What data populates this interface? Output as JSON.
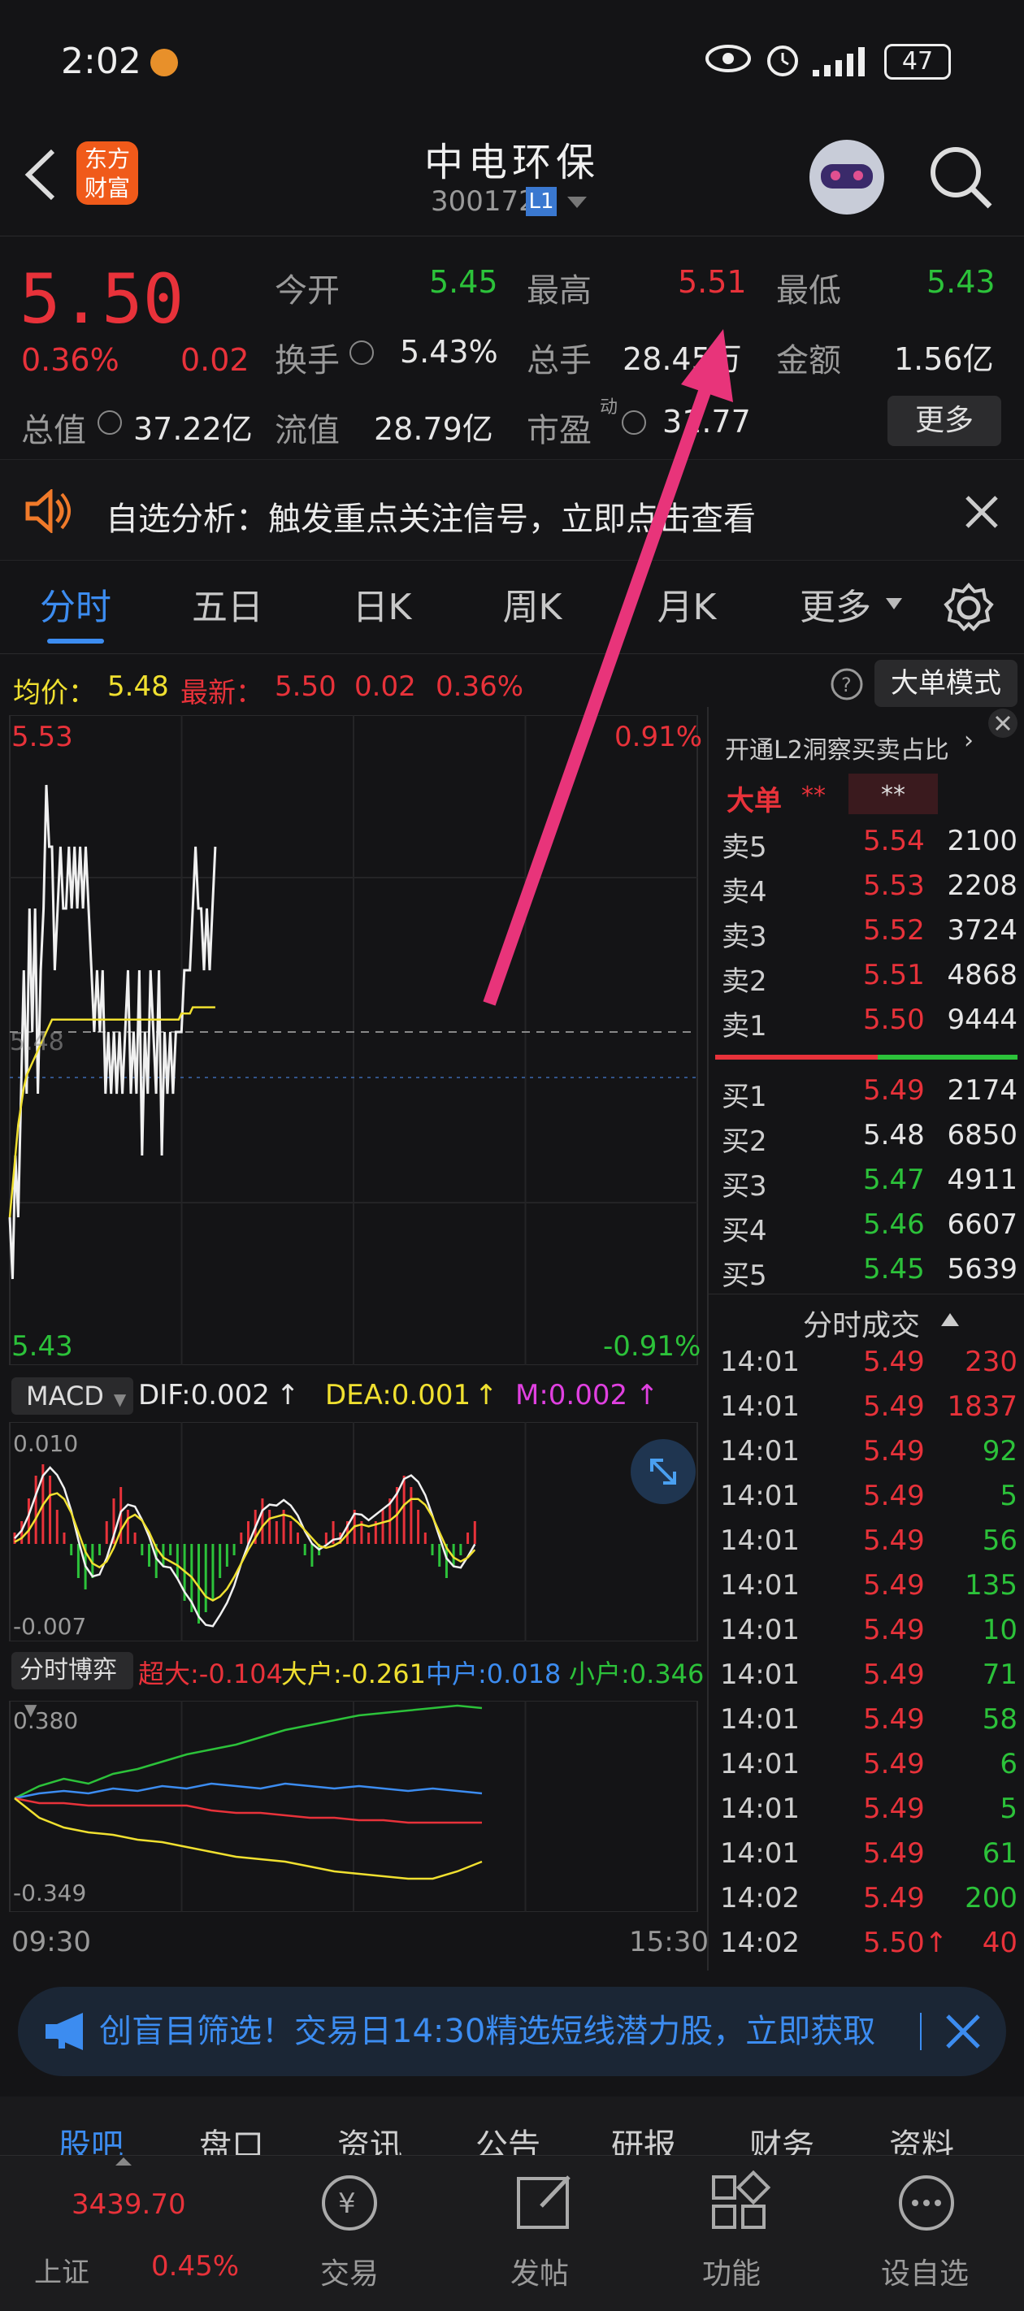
{
  "status_bar": {
    "time": "2:02",
    "battery": "47"
  },
  "header": {
    "title": "中电环保",
    "code": "300172",
    "level_badge": "L1",
    "logo_line1": "东方",
    "logo_line2": "财富"
  },
  "quote": {
    "price": "5.50",
    "change_pct": "0.36%",
    "change": "0.02",
    "open_label": "今开",
    "open": "5.45",
    "high_label": "最高",
    "high": "5.51",
    "low_label": "最低",
    "low": "5.43",
    "turnover_label": "换手",
    "turnover": "5.43%",
    "volume_label": "总手",
    "volume": "28.45万",
    "amount_label": "金额",
    "amount": "1.56亿",
    "mktcap_label": "总值",
    "mktcap": "37.22亿",
    "float_label": "流值",
    "float": "28.79亿",
    "pe_label": "市盈",
    "pe_sup": "动",
    "pe": "31.77",
    "more_button": "更多"
  },
  "notice": {
    "text": "自选分析：触发重点关注信号，立即点击查看"
  },
  "tabs": [
    "分时",
    "五日",
    "日K",
    "周K",
    "月K",
    "更多"
  ],
  "chart_info": {
    "avg_label": "均价：",
    "avg": "5.48",
    "latest_label": "最新：",
    "latest": "5.50",
    "latest_change": "0.02",
    "latest_pct": "0.36%",
    "mode_button": "大单模式"
  },
  "price_axis": {
    "top": "5.53",
    "bottom": "5.43",
    "top_pct": "0.91%",
    "bottom_pct": "-0.91%",
    "mid": "5.48"
  },
  "macd": {
    "selector": "MACD",
    "dif": "DIF:0.002",
    "dea": "DEA:0.001",
    "m": "M:0.002",
    "top": "0.010",
    "bottom": "-0.007"
  },
  "flow": {
    "selector": "分时博弈",
    "super": "超大:-0.104",
    "large": "大户:-0.261",
    "mid": "中户:0.018",
    "small": "小户:0.346",
    "top": "0.380",
    "bottom": "-0.349"
  },
  "time_axis": {
    "start": "09:30",
    "end": "15:30"
  },
  "orderbook": {
    "l2_link": "开通L2洞察买卖占比",
    "big_order_label": "大单",
    "stars1": "**",
    "stars2": "**",
    "asks": [
      {
        "label": "卖5",
        "price": "5.54",
        "vol": "2100"
      },
      {
        "label": "卖4",
        "price": "5.53",
        "vol": "2208"
      },
      {
        "label": "卖3",
        "price": "5.52",
        "vol": "3724"
      },
      {
        "label": "卖2",
        "price": "5.51",
        "vol": "4868"
      },
      {
        "label": "卖1",
        "price": "5.50",
        "vol": "9444"
      }
    ],
    "bids": [
      {
        "label": "买1",
        "price": "5.49",
        "vol": "2174"
      },
      {
        "label": "买2",
        "price": "5.48",
        "vol": "6850"
      },
      {
        "label": "买3",
        "price": "5.47",
        "vol": "4911"
      },
      {
        "label": "买4",
        "price": "5.46",
        "vol": "6607"
      },
      {
        "label": "买5",
        "price": "5.45",
        "vol": "5639"
      }
    ],
    "trades_title": "分时成交",
    "trades": [
      {
        "t": "14:01",
        "p": "5.49",
        "v": "230",
        "c": "red"
      },
      {
        "t": "14:01",
        "p": "5.49",
        "v": "1837",
        "c": "red"
      },
      {
        "t": "14:01",
        "p": "5.49",
        "v": "92",
        "c": "green"
      },
      {
        "t": "14:01",
        "p": "5.49",
        "v": "5",
        "c": "green"
      },
      {
        "t": "14:01",
        "p": "5.49",
        "v": "56",
        "c": "green"
      },
      {
        "t": "14:01",
        "p": "5.49",
        "v": "135",
        "c": "green"
      },
      {
        "t": "14:01",
        "p": "5.49",
        "v": "10",
        "c": "green"
      },
      {
        "t": "14:01",
        "p": "5.49",
        "v": "71",
        "c": "green"
      },
      {
        "t": "14:01",
        "p": "5.49",
        "v": "58",
        "c": "green"
      },
      {
        "t": "14:01",
        "p": "5.49",
        "v": "6",
        "c": "green"
      },
      {
        "t": "14:01",
        "p": "5.49",
        "v": "5",
        "c": "green"
      },
      {
        "t": "14:01",
        "p": "5.49",
        "v": "61",
        "c": "green"
      },
      {
        "t": "14:02",
        "p": "5.49",
        "v": "200",
        "c": "green"
      },
      {
        "t": "14:02",
        "p": "5.50↑",
        "v": "40",
        "c": "red"
      }
    ]
  },
  "banner": {
    "text": "创盲目筛选！交易日14:30精选短线潜力股，立即获取"
  },
  "bottom_tabs": [
    "股吧",
    "盘口",
    "资讯",
    "公告",
    "研报",
    "财务",
    "资料"
  ],
  "index": {
    "name": "上证",
    "value": "3439.70",
    "pct": "0.45%"
  },
  "nav": [
    "交易",
    "发帖",
    "功能",
    "设自选"
  ],
  "colors": {
    "up": "#e8323a",
    "down": "#2cc23a",
    "bg": "#141416",
    "accent": "#3c8cf0",
    "arrow": "#e8347a"
  },
  "chart_data": {
    "type": "line",
    "ylim": [
      5.43,
      5.53
    ],
    "series": [
      {
        "name": "价格",
        "values": [
          5.45,
          5.44,
          5.46,
          5.45,
          5.47,
          5.49,
          5.47,
          5.5,
          5.48,
          5.5,
          5.47,
          5.49,
          5.5,
          5.52,
          5.51,
          5.51,
          5.49,
          5.5,
          5.51,
          5.5,
          5.5,
          5.51,
          5.5,
          5.51,
          5.5,
          5.51,
          5.5,
          5.51,
          5.5,
          5.49,
          5.48,
          5.49,
          5.48,
          5.49,
          5.47,
          5.48,
          5.47,
          5.48,
          5.47,
          5.48,
          5.47,
          5.48,
          5.49,
          5.47,
          5.48,
          5.47,
          5.49,
          5.46,
          5.48,
          5.47,
          5.49,
          5.48,
          5.47,
          5.49,
          5.46,
          5.48,
          5.47,
          5.48,
          5.47,
          5.48,
          5.48,
          5.48,
          5.49,
          5.49,
          5.49,
          5.5,
          5.51,
          5.5,
          5.5,
          5.49,
          5.5,
          5.49,
          5.5,
          5.51
        ]
      },
      {
        "name": "均价",
        "values": [
          5.45,
          5.455,
          5.46,
          5.465,
          5.468,
          5.471,
          5.473,
          5.474,
          5.475,
          5.476,
          5.477,
          5.478,
          5.479,
          5.48,
          5.481,
          5.482,
          5.482,
          5.482,
          5.482,
          5.482,
          5.482,
          5.482,
          5.482,
          5.482,
          5.482,
          5.482,
          5.482,
          5.482,
          5.482,
          5.482,
          5.482,
          5.482,
          5.482,
          5.482,
          5.482,
          5.482,
          5.482,
          5.482,
          5.482,
          5.482,
          5.482,
          5.482,
          5.482,
          5.482,
          5.482,
          5.482,
          5.482,
          5.482,
          5.482,
          5.482,
          5.482,
          5.482,
          5.482,
          5.482,
          5.482,
          5.482,
          5.482,
          5.482,
          5.482,
          5.482,
          5.482,
          5.483,
          5.483,
          5.483,
          5.483,
          5.484,
          5.484,
          5.484,
          5.484,
          5.484,
          5.484,
          5.484,
          5.484,
          5.484
        ]
      }
    ],
    "macd_bars": [
      1,
      2,
      4,
      6,
      7,
      6,
      3,
      1,
      -1,
      -3,
      -4,
      -3,
      -1,
      2,
      4,
      5,
      3,
      1,
      -1,
      -2,
      -3,
      -2,
      -1,
      -3,
      -5,
      -6,
      -7,
      -6,
      -5,
      -3,
      -2,
      -1,
      1,
      2,
      3,
      4,
      3,
      2,
      3,
      2,
      1,
      -1,
      -2,
      -1,
      1,
      2,
      1,
      2,
      3,
      2,
      1,
      2,
      3,
      4,
      5,
      6,
      5,
      3,
      1,
      -1,
      -2,
      -3,
      -2,
      -1,
      1,
      2
    ],
    "flow_series": [
      {
        "name": "小户",
        "values": [
          0.0,
          0.05,
          0.08,
          0.06,
          0.1,
          0.12,
          0.15,
          0.18,
          0.2,
          0.22,
          0.25,
          0.28,
          0.3,
          0.32,
          0.34,
          0.35,
          0.36,
          0.37,
          0.38,
          0.37
        ]
      },
      {
        "name": "中户",
        "values": [
          0.0,
          0.02,
          0.03,
          0.02,
          0.04,
          0.03,
          0.05,
          0.04,
          0.06,
          0.05,
          0.04,
          0.06,
          0.05,
          0.04,
          0.05,
          0.04,
          0.03,
          0.04,
          0.03,
          0.02
        ]
      },
      {
        "name": "超大",
        "values": [
          0.0,
          -0.02,
          -0.02,
          -0.03,
          -0.03,
          -0.03,
          -0.03,
          -0.03,
          -0.05,
          -0.06,
          -0.06,
          -0.07,
          -0.08,
          -0.08,
          -0.09,
          -0.09,
          -0.1,
          -0.1,
          -0.1,
          -0.1
        ]
      },
      {
        "name": "大户",
        "values": [
          0.0,
          -0.08,
          -0.12,
          -0.14,
          -0.15,
          -0.17,
          -0.18,
          -0.2,
          -0.22,
          -0.24,
          -0.25,
          -0.26,
          -0.28,
          -0.3,
          -0.31,
          -0.32,
          -0.33,
          -0.33,
          -0.3,
          -0.26
        ]
      }
    ]
  }
}
